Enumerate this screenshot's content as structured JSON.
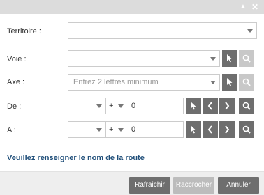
{
  "window": {
    "collapse_icon": "triangle-up-icon",
    "close_icon": "close-icon",
    "collapse_glyph": "▲",
    "close_glyph": "✕"
  },
  "form": {
    "territoire": {
      "label": "Territoire :",
      "value": ""
    },
    "voie": {
      "label": "Voie :",
      "value": ""
    },
    "axe": {
      "label": "Axe :",
      "placeholder": "Entrez 2 lettres minimum"
    },
    "de": {
      "label": "De :",
      "select_value": "",
      "sign_value": "+",
      "number_value": "0"
    },
    "a": {
      "label": "A :",
      "select_value": "",
      "sign_value": "+",
      "number_value": "0"
    }
  },
  "message": "Veuillez renseigner le nom de la route",
  "footer": {
    "refresh_label": "Rafraichir",
    "attach_label": "Raccrocher",
    "cancel_label": "Annuler"
  },
  "colors": {
    "button_dark": "#6e6e6e",
    "button_disabled": "#c8c8c8",
    "message": "#1f4e79"
  }
}
